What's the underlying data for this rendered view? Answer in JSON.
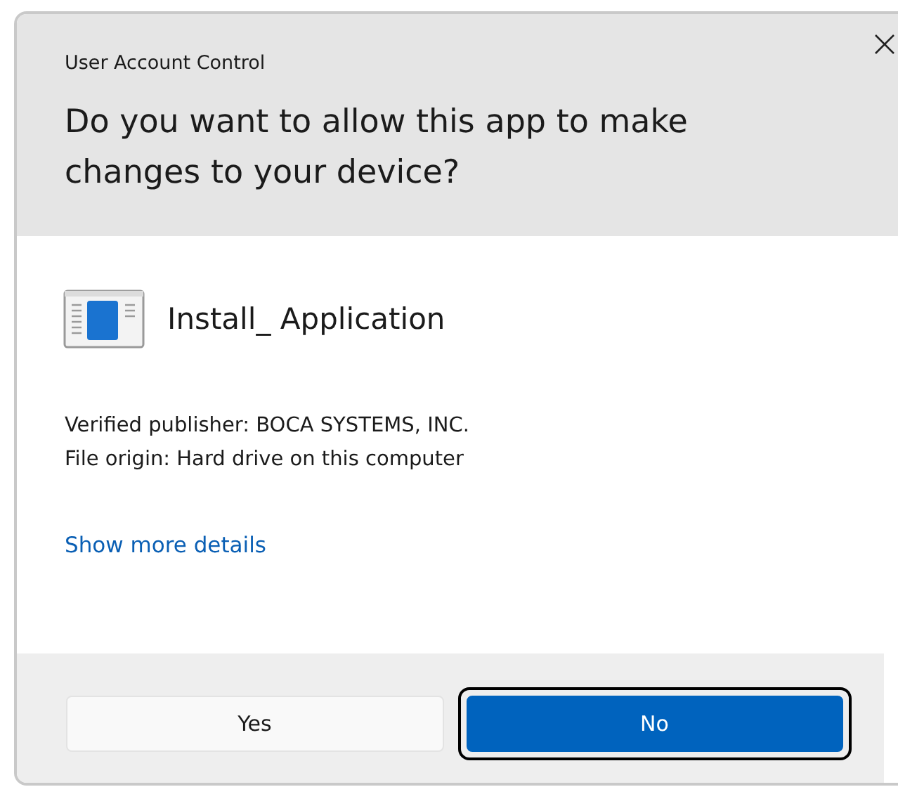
{
  "window": {
    "title": "User Account Control"
  },
  "question": "Do you want to allow this app to make changes to your device?",
  "app": {
    "name": "Install_ Application"
  },
  "details": [
    "Verified publisher: BOCA SYSTEMS, INC.",
    "File origin: Hard drive on this computer"
  ],
  "link": "Show more details",
  "buttons": [
    {
      "label": "Yes",
      "kind": "secondary",
      "focused": false
    },
    {
      "label": "No",
      "kind": "primary",
      "focused": true
    }
  ]
}
